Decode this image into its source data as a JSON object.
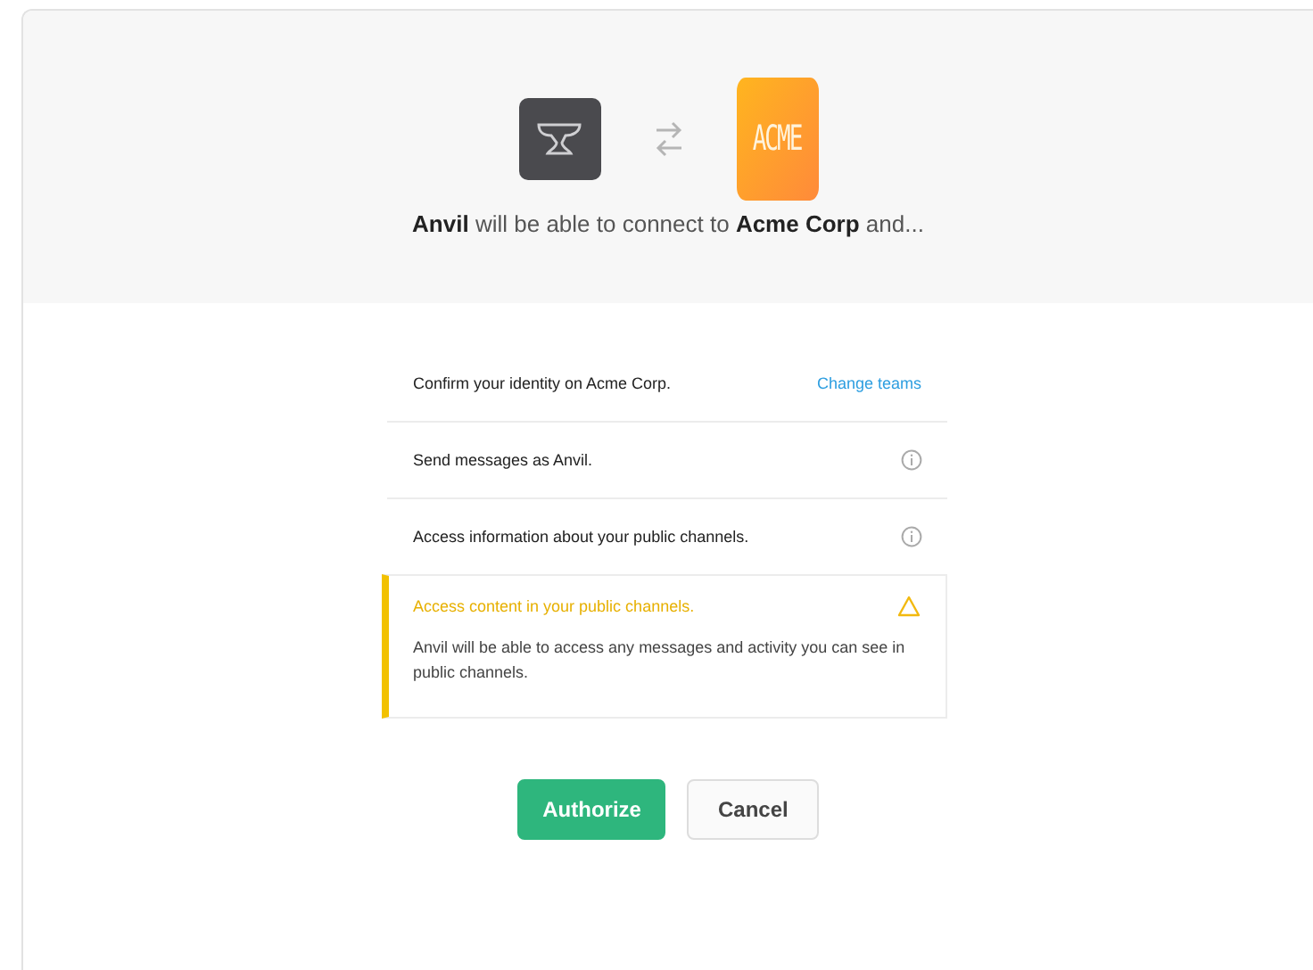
{
  "header": {
    "app_logo": {
      "kind": "anvil"
    },
    "partner_logo": {
      "text": "ACME"
    },
    "summary": "**Anvil** will be able to connect to **Acme Corp** and..."
  },
  "permissions": [
    {
      "kind": "identity",
      "title": "Confirm your identity on Acme Corp.",
      "action": "Change teams"
    },
    {
      "kind": "info",
      "title": "Send messages as Anvil."
    },
    {
      "kind": "info",
      "title": "Access information about your public channels."
    },
    {
      "kind": "warning",
      "title": "Access content in your public channels.",
      "description": "Anvil will be able to access any messages and activity you can see in public channels."
    }
  ],
  "buttons": [
    {
      "label": "Authorize",
      "kind": "primary"
    },
    {
      "label": "Cancel",
      "kind": "secondary"
    }
  ]
}
